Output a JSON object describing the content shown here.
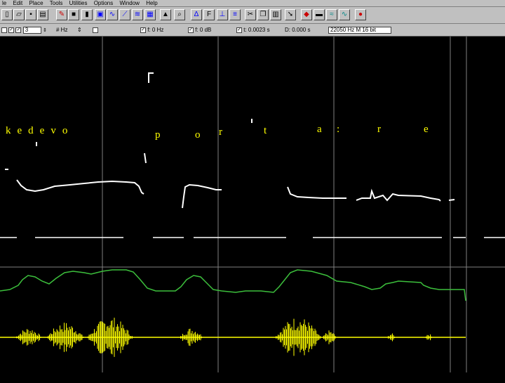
{
  "menu": [
    "le",
    "Edit",
    "Place",
    "Tools",
    "Utilities",
    "Options",
    "Window",
    "Help"
  ],
  "toolbar": {
    "icons": [
      "new-file-icon",
      "open-folder-icon",
      "save-disk-icon",
      "print-icon",
      "record-icon",
      "stop-icon",
      "play-icon",
      "zoom-icon",
      "waveform-icon",
      "pitch-icon",
      "spectrum-icon",
      "hat-icon",
      "magnifier-icon",
      "formant-icon",
      "font-icon",
      "filter-icon",
      "scissors-icon",
      "copy-icon",
      "paste-icon",
      "arrow-icon",
      "speaker-icon",
      "wave-icon",
      "tone-icon",
      "color-palette-icon"
    ]
  },
  "status": {
    "channel_value": "3",
    "step_label": "# Hz",
    "f1_label": "f: 0 Hz",
    "f2_label": "f: 0 dB",
    "t1_label": "t: 0.0023 s",
    "d_label": "D: 0.000 s",
    "freq_label": "22050 Hz   M 16 bit"
  },
  "phonemes": {
    "line1": "kedevo",
    "p": "p",
    "o": "o",
    "r": "r",
    "t": "t",
    "a": "a",
    "colon": ":",
    "r2": "r",
    "e": "e"
  },
  "colors": {
    "labels": "#ffff00",
    "pitch": "#ffffff",
    "intensity": "#3cbf3c",
    "waveform": "#ffff00",
    "grid": "#808080"
  }
}
